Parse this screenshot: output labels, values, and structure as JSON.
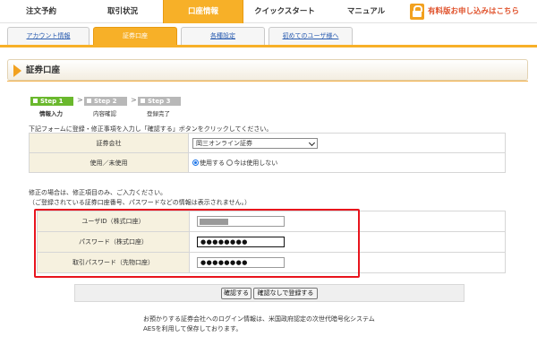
{
  "nav": {
    "items": [
      "注文予約",
      "取引状況",
      "口座情報",
      "クイックスタート",
      "マニュアル"
    ],
    "active_index": 2,
    "cta_label": "有料版お申し込みはこちら",
    "cta_icon": "lock-icon"
  },
  "subtabs": {
    "items": [
      "アカウント情報",
      "証券口座",
      "各種設定",
      "初めてのユーザ様へ"
    ],
    "active_index": 1
  },
  "page": {
    "title": "証券口座"
  },
  "steps": [
    {
      "label": "Step 1",
      "caption": "情報入力",
      "active": true
    },
    {
      "label": "Step 2",
      "caption": "内容確認",
      "active": false
    },
    {
      "label": "Step 3",
      "caption": "登録完了",
      "active": false
    }
  ],
  "step_separator": ">",
  "instruction": "下記フォームに登録・修正事項を入力し「確認する」ボタンをクリックしてください。",
  "account_table": {
    "company_label": "証券会社",
    "company_value": "岡三オンライン証券",
    "use_label": "使用／未使用",
    "use_option_on": "使用する",
    "use_option_off": "今は使用しない",
    "use_selected": "使用する"
  },
  "notes": {
    "line1": "修正の場合は、修正項目のみ、ご入力ください。",
    "line2": "（ご登録されている証券口座番号、パスワードなどの情報は表示されません。）"
  },
  "login_table": {
    "user_id_label": "ユーザID（株式口座）",
    "password_label": "パスワード（株式口座）",
    "password_value": "●●●●●●●●",
    "trade_password_label": "取引パスワード（先物口座）",
    "trade_password_value": "●●●●●●●●"
  },
  "buttons": {
    "confirm": "確認する",
    "register_direct": "確認なしで登録する"
  },
  "footer": {
    "line1": "お預かりする証券会社へのログイン情報は、米国政府認定の次世代暗号化システム",
    "line2": "AESを利用して保存しております。"
  },
  "colors": {
    "nav_active": "#f7b028",
    "step_active": "#6ab82d",
    "step_inactive": "#b8b8b8",
    "highlight_box": "#e8141d",
    "cta_text": "#e0532d"
  }
}
